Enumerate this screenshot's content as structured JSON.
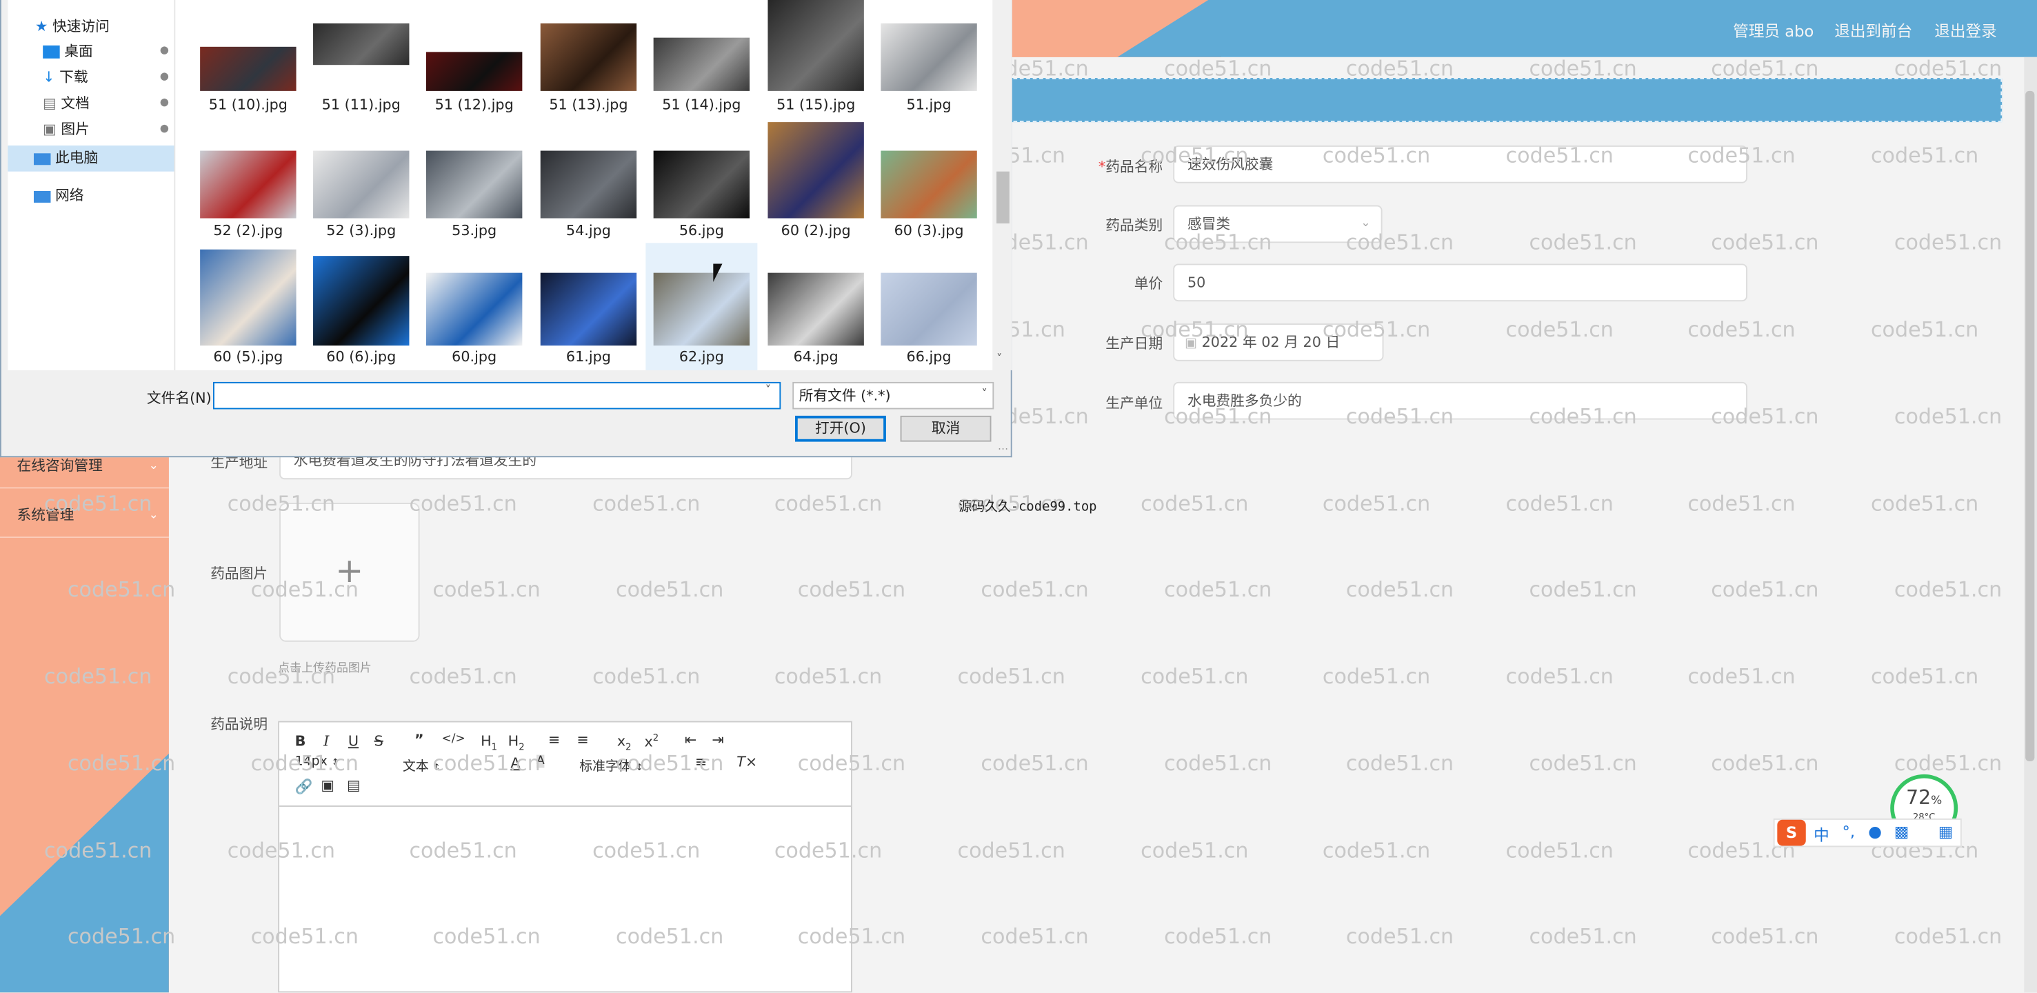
{
  "header": {
    "user": "管理员 abo",
    "front_link": "退出到前台",
    "logout": "退出登录"
  },
  "watermark": "code51.cn",
  "watermark2": "源码久久-code99.top",
  "sidebar": {
    "items": [
      {
        "label": "在线咨询管理"
      },
      {
        "label": "系统管理"
      }
    ]
  },
  "form": {
    "name_label": "药品名称",
    "name_value": "速效伤风胶囊",
    "category_label": "药品类别",
    "category_value": "感冒类",
    "price_label": "单价",
    "price_value": "50",
    "date_label": "生产日期",
    "date_value": "2022 年 02 月 20 日",
    "maker_label": "生产单位",
    "maker_value": "水电费胜多负少的",
    "address_label": "生产地址",
    "address_value": "水电费看道发生的防守打法看道发生的",
    "image_label": "药品图片",
    "image_hint": "点击上传药品图片",
    "desc_label": "药品说明"
  },
  "editor": {
    "font_size": "14px",
    "block_type": "文本",
    "font_family": "标准字体"
  },
  "dialog": {
    "nav": {
      "quick_access": "快速访问",
      "desktop": "桌面",
      "downloads": "下载",
      "documents": "文档",
      "pictures": "图片",
      "this_pc": "此电脑",
      "network": "网络"
    },
    "files": [
      {
        "name": "51 (10).jpg"
      },
      {
        "name": "51 (11).jpg"
      },
      {
        "name": "51 (12).jpg"
      },
      {
        "name": "51 (13).jpg"
      },
      {
        "name": "51 (14).jpg"
      },
      {
        "name": "51 (15).jpg"
      },
      {
        "name": "51.jpg"
      },
      {
        "name": "52 (2).jpg"
      },
      {
        "name": "52 (3).jpg"
      },
      {
        "name": "53.jpg"
      },
      {
        "name": "54.jpg"
      },
      {
        "name": "56.jpg"
      },
      {
        "name": "60 (2).jpg"
      },
      {
        "name": "60 (3).jpg"
      },
      {
        "name": "60 (5).jpg"
      },
      {
        "name": "60 (6).jpg"
      },
      {
        "name": "60.jpg"
      },
      {
        "name": "61.jpg"
      },
      {
        "name": "62.jpg"
      },
      {
        "name": "64.jpg"
      },
      {
        "name": "66.jpg"
      }
    ],
    "filename_label": "文件名(N):",
    "filename_value": "",
    "filetype": "所有文件 (*.*)",
    "open": "打开(O)",
    "cancel": "取消"
  },
  "widgets": {
    "memory_percent": "72",
    "memory_unit": "%",
    "temperature": "28°C",
    "ime_lang": "中"
  }
}
